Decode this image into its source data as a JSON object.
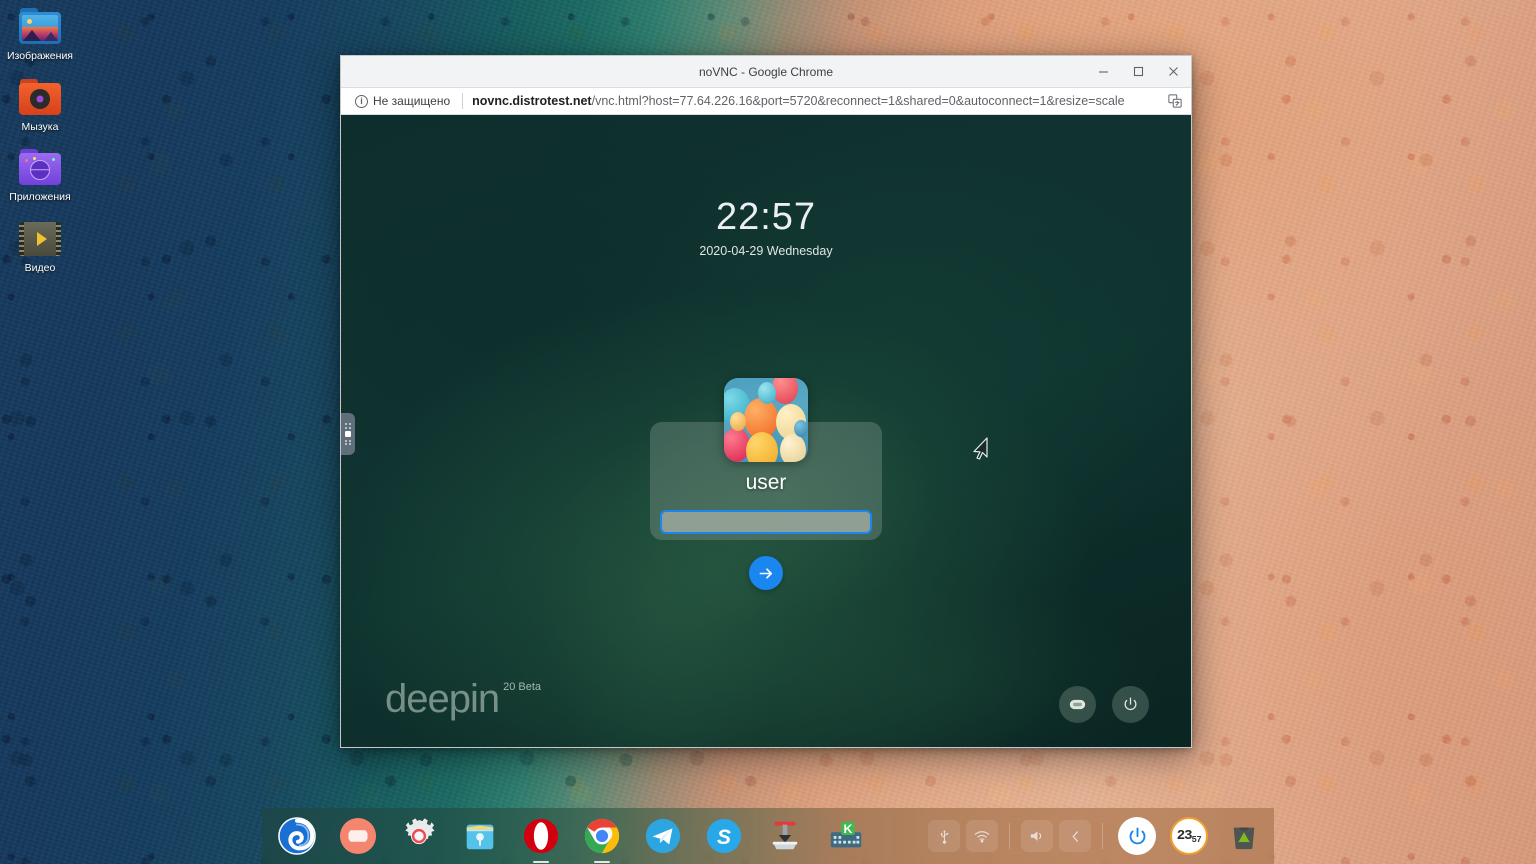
{
  "desktop": {
    "icons": [
      {
        "label": "Изображения",
        "icon": "pictures-folder-icon"
      },
      {
        "label": "Мызука",
        "icon": "music-folder-icon"
      },
      {
        "label": "Приложения",
        "icon": "applications-folder-icon"
      },
      {
        "label": "Видео",
        "icon": "video-folder-icon"
      }
    ]
  },
  "browser": {
    "window_title": "noVNC - Google Chrome",
    "security_label": "Не защищено",
    "security_icon": "info-circle-icon",
    "url_host": "novnc.distrotest.net",
    "url_path": "/vnc.html?host=77.64.226.16&port=5720&reconnect=1&shared=0&autoconnect=1&resize=scale",
    "translate_icon": "translate-icon",
    "controls": {
      "minimize": "minimize-icon",
      "maximize": "maximize-icon",
      "close": "close-icon"
    }
  },
  "greeter": {
    "time": "22:57",
    "date": "2020-04-29 Wednesday",
    "username": "user",
    "password_value": "",
    "password_placeholder": "",
    "submit_icon": "arrow-right-icon",
    "brand_name": "deepin",
    "brand_version": "20 Beta",
    "actions": [
      {
        "name": "keyboard-layout-button",
        "icon": "keyboard-icon"
      },
      {
        "name": "power-button",
        "icon": "power-icon"
      }
    ],
    "vnc_handle": "novnc-panel-handle"
  },
  "dock": {
    "apps": [
      {
        "name": "deepin-launcher",
        "icon": "deepin-spiral-icon",
        "running": false
      },
      {
        "name": "deepin-movie",
        "icon": "movie-icon",
        "running": false
      },
      {
        "name": "deepin-control-center",
        "icon": "gear-icon",
        "running": false
      },
      {
        "name": "deepin-file-manager",
        "icon": "file-manager-icon",
        "running": false
      },
      {
        "name": "opera-browser",
        "icon": "opera-icon",
        "running": true
      },
      {
        "name": "google-chrome",
        "icon": "chrome-icon",
        "running": true
      },
      {
        "name": "telegram",
        "icon": "telegram-icon",
        "running": false
      },
      {
        "name": "skype",
        "icon": "skype-icon",
        "running": false
      },
      {
        "name": "deepin-installer",
        "icon": "package-install-icon",
        "running": false
      },
      {
        "name": "kde-virtual-keyboard",
        "icon": "keyboard-k-icon",
        "running": false
      }
    ],
    "tray": [
      {
        "name": "usb-tray-icon",
        "icon": "usb-icon"
      },
      {
        "name": "network-tray-icon",
        "icon": "wifi-icon"
      },
      {
        "name": "volume-tray-icon",
        "icon": "speaker-icon"
      },
      {
        "name": "tray-expand-button",
        "icon": "chevron-left-icon"
      }
    ],
    "power_button": "power-icon",
    "clock": {
      "hours": "23",
      "minutes": "57"
    },
    "trash": "trash-icon"
  },
  "colors": {
    "accent_blue": "#1a86f0",
    "greeter_bg": "#0f3230",
    "clock_ring": "#f0a22a",
    "chrome_toolbar": "#ffffff"
  }
}
